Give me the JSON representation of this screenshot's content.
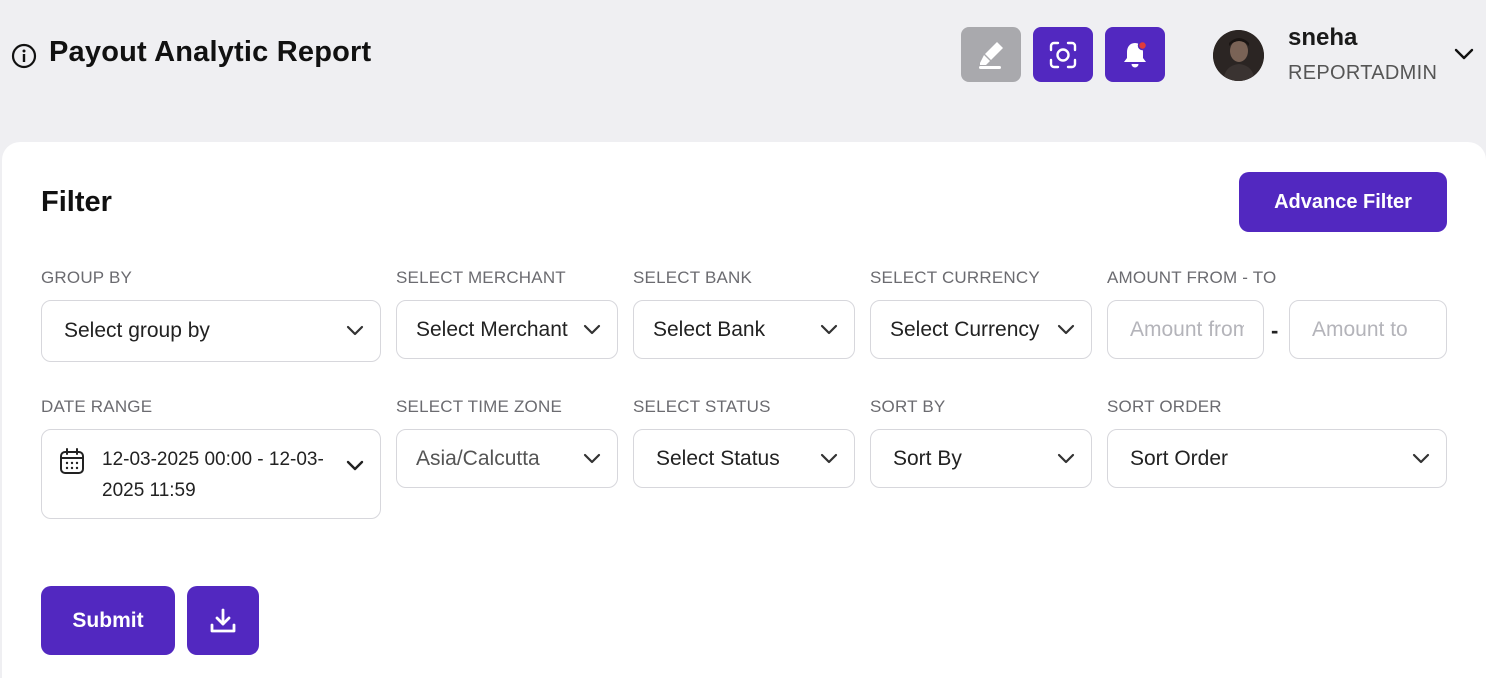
{
  "header": {
    "title": "Payout Analytic Report",
    "icons": {
      "info": "info-icon",
      "highlighter": "highlighter-icon",
      "scan": "screen-capture-icon",
      "bell": "notification-bell-icon"
    },
    "user": {
      "name": "sneha",
      "role": "REPORTADMIN"
    }
  },
  "filter": {
    "title": "Filter",
    "advance_filter_label": "Advance Filter",
    "group_by": {
      "label": "GROUP BY",
      "value": "Select group by"
    },
    "merchant": {
      "label": "SELECT MERCHANT",
      "value": "Select Merchant"
    },
    "bank": {
      "label": "SELECT BANK",
      "value": "Select Bank"
    },
    "currency": {
      "label": "SELECT CURRENCY",
      "value": "Select Currency"
    },
    "amount": {
      "label": "AMOUNT FROM - TO",
      "from_placeholder": "Amount from",
      "to_placeholder": "Amount to",
      "separator": "-"
    },
    "date_range": {
      "label": "DATE RANGE",
      "value": "12-03-2025 00:00 - 12-03-2025 11:59"
    },
    "time_zone": {
      "label": "SELECT TIME ZONE",
      "value": "Asia/Calcutta"
    },
    "status": {
      "label": "SELECT STATUS",
      "value": "Select Status"
    },
    "sort_by": {
      "label": "SORT BY",
      "value": "Sort By"
    },
    "sort_order": {
      "label": "SORT ORDER",
      "value": "Sort Order"
    },
    "submit_label": "Submit"
  },
  "colors": {
    "accent": "#5228c0",
    "background": "#efeff2",
    "disabled_button": "#a9a9ad"
  }
}
